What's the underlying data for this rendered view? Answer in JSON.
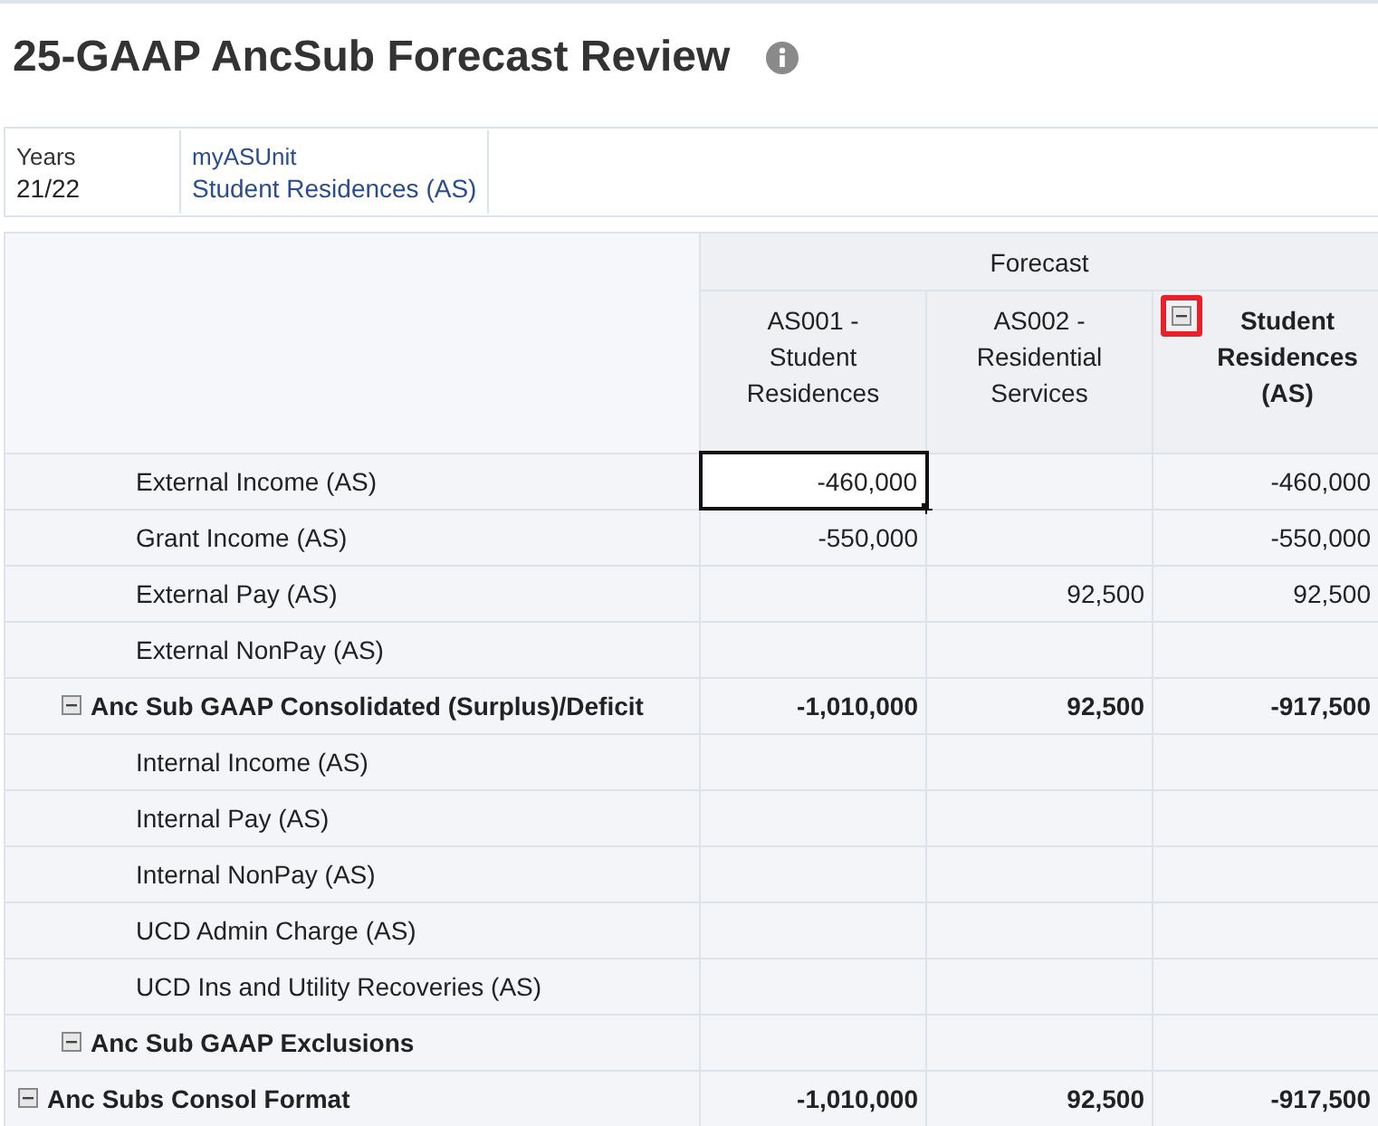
{
  "title": "25-GAAP AncSub Forecast Review",
  "pov": [
    {
      "label": "Years",
      "value": "21/22",
      "link": false
    },
    {
      "label": "myASUnit",
      "value": "Student Residences (AS)",
      "link": true
    }
  ],
  "grid": {
    "group_header": "Forecast",
    "columns": [
      {
        "label": "AS001 -\nStudent\nResidences",
        "kind": "member"
      },
      {
        "label": "AS002 -\nResidential\nServices",
        "kind": "member"
      },
      {
        "label": "Student\nResidences\n(AS)",
        "kind": "parent",
        "expanded": true,
        "highlighted": true
      }
    ],
    "rows": [
      {
        "label": "Anc Subs Consol Format",
        "expanded": true,
        "cells": [
          {
            "value": "-1,010,000",
            "selected": false
          },
          {
            "value": "92,500",
            "selected": false
          },
          {
            "value": "-917,500",
            "selected": false
          }
        ],
        "children": [
          {
            "label": "Anc Sub GAAP Consolidated (Surplus)/Deficit",
            "expanded": true,
            "cells": [
              {
                "value": "-1,010,000",
                "selected": false
              },
              {
                "value": "92,500",
                "selected": false
              },
              {
                "value": "-917,500",
                "selected": false
              }
            ],
            "children": [
              {
                "label": "External Income (AS)",
                "cells": [
                  {
                    "value": "-460,000",
                    "selected": true
                  },
                  {
                    "selected": false
                  },
                  {
                    "value": "-460,000",
                    "selected": false
                  }
                ]
              },
              {
                "label": "Grant Income (AS)",
                "cells": [
                  {
                    "value": "-550,000",
                    "selected": false
                  },
                  {
                    "selected": false
                  },
                  {
                    "value": "-550,000",
                    "selected": false
                  }
                ]
              },
              {
                "label": "External Pay (AS)",
                "cells": [
                  {
                    "selected": false
                  },
                  {
                    "value": "92,500",
                    "selected": false
                  },
                  {
                    "value": "92,500",
                    "selected": false
                  }
                ]
              },
              {
                "label": "External NonPay (AS)",
                "cells": [
                  {
                    "selected": false
                  },
                  {
                    "selected": false
                  },
                  {
                    "selected": false
                  }
                ]
              }
            ]
          },
          {
            "label": "Anc Sub GAAP Exclusions",
            "expanded": true,
            "cells": [
              {
                "selected": false
              },
              {
                "selected": false
              },
              {
                "selected": false
              }
            ],
            "children": [
              {
                "label": "Internal Income (AS)",
                "cells": [
                  {
                    "selected": false
                  },
                  {
                    "selected": false
                  },
                  {
                    "selected": false
                  }
                ]
              },
              {
                "label": "Internal Pay (AS)",
                "cells": [
                  {
                    "selected": false
                  },
                  {
                    "selected": false
                  },
                  {
                    "selected": false
                  }
                ]
              },
              {
                "label": "Internal NonPay (AS)",
                "cells": [
                  {
                    "selected": false
                  },
                  {
                    "selected": false
                  },
                  {
                    "selected": false
                  }
                ]
              },
              {
                "label": "UCD Admin Charge (AS)",
                "cells": [
                  {
                    "selected": false
                  },
                  {
                    "selected": false
                  },
                  {
                    "selected": false
                  }
                ]
              },
              {
                "label": "UCD Ins and Utility Recoveries (AS)",
                "cells": [
                  {
                    "selected": false
                  },
                  {
                    "selected": false
                  },
                  {
                    "selected": false
                  }
                ]
              }
            ]
          }
        ]
      }
    ]
  }
}
